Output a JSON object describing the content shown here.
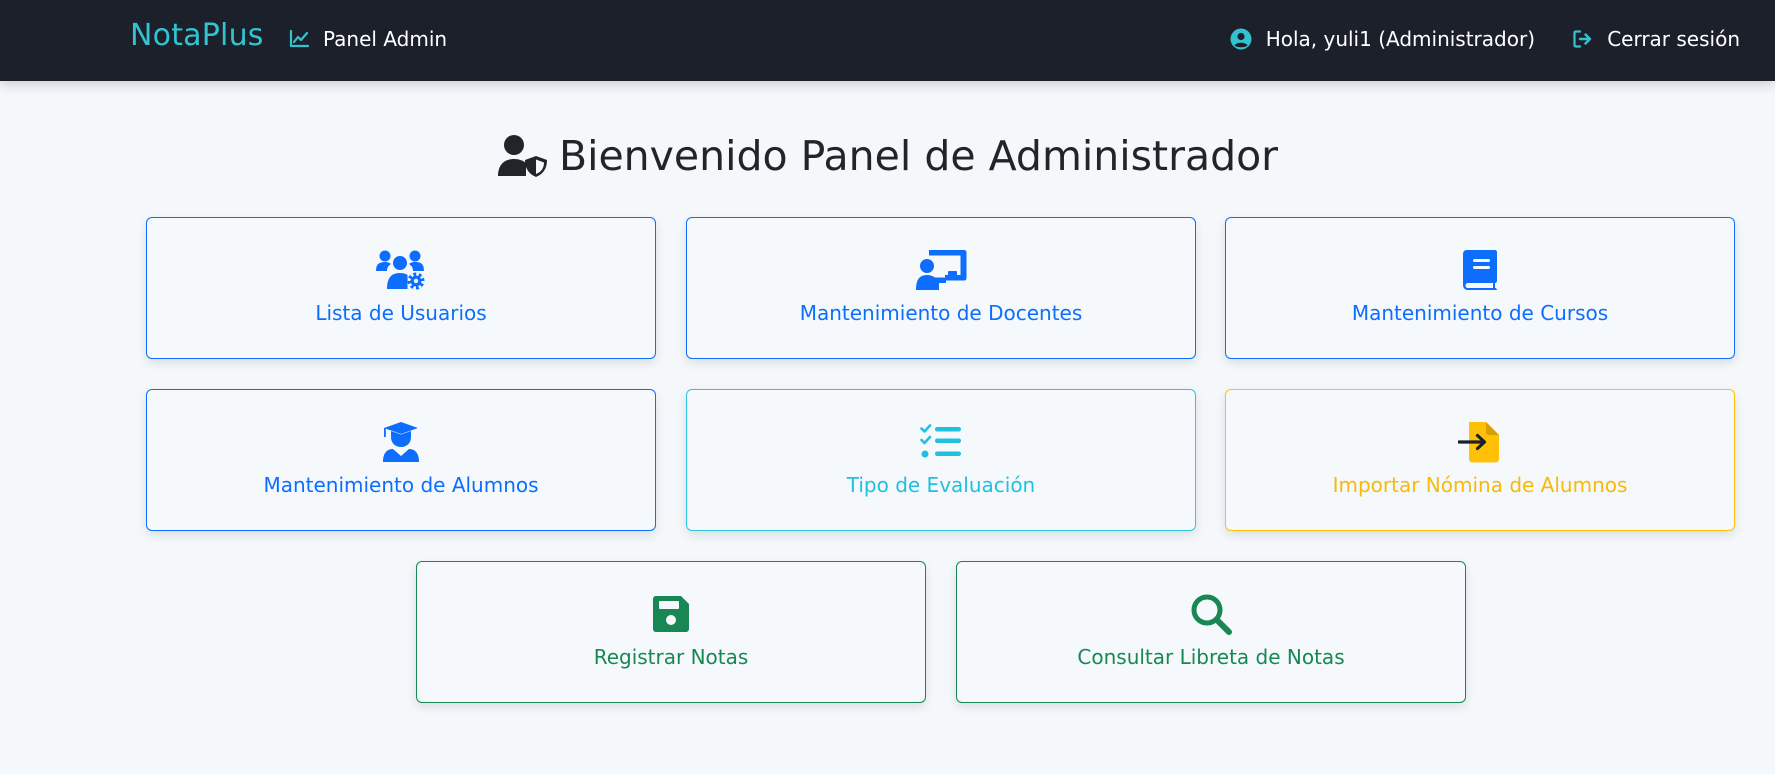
{
  "navbar": {
    "brand": "NotaPlus",
    "panel_link": "Panel Admin",
    "user_greeting": "Hola, yuli1 (Administrador)",
    "logout": "Cerrar sesión",
    "accent_color": "#33c3cf",
    "background": "#1b202b",
    "icons": {
      "panel": "chart-line-icon",
      "user": "user-circle-icon",
      "logout": "sign-out-icon"
    }
  },
  "main": {
    "title": "Bienvenido Panel de Administrador",
    "title_icon": "user-shield-icon",
    "cards": [
      {
        "label": "Lista de Usuarios",
        "icon": "users-cog-icon",
        "color": "#0d6efd"
      },
      {
        "label": "Mantenimiento de Docentes",
        "icon": "chalkboard-teacher-icon",
        "color": "#0d6efd"
      },
      {
        "label": "Mantenimiento de Cursos",
        "icon": "book-icon",
        "color": "#0d6efd"
      },
      {
        "label": "Mantenimiento de Alumnos",
        "icon": "user-graduate-icon",
        "color": "#0d6efd"
      },
      {
        "label": "Tipo de Evaluación",
        "icon": "list-check-icon",
        "color": "#21bfe0"
      },
      {
        "label": "Importar Nómina de Alumnos",
        "icon": "file-import-icon",
        "color": "#ffc107"
      },
      {
        "label": "Registrar Notas",
        "icon": "floppy-disk-icon",
        "color": "#198754"
      },
      {
        "label": "Consultar Libreta de Notas",
        "icon": "search-icon",
        "color": "#198754"
      }
    ]
  }
}
